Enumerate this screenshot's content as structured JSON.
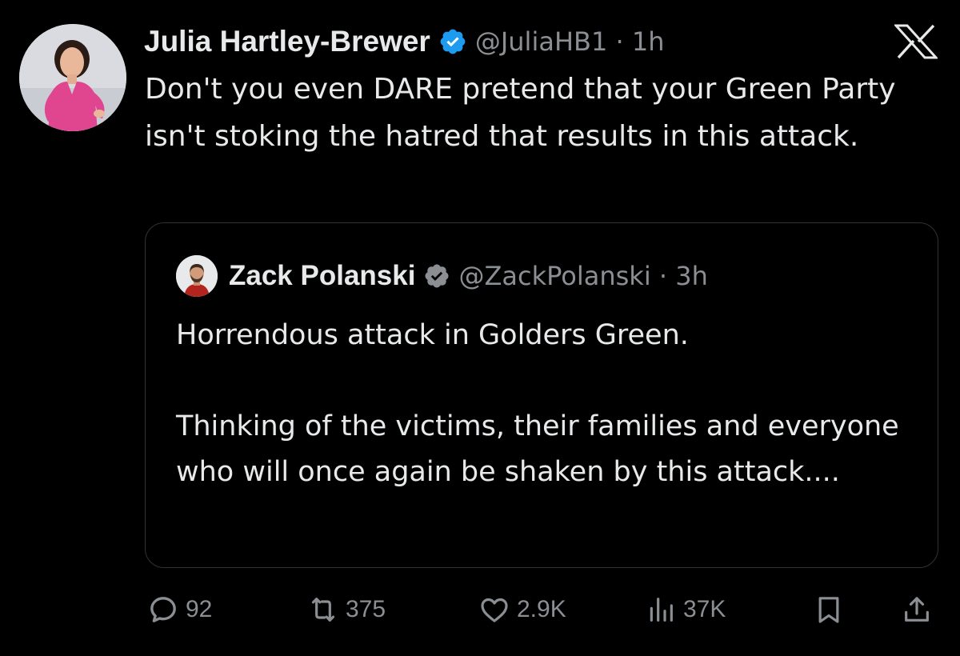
{
  "tweet": {
    "author_name": "Julia Hartley-Brewer",
    "author_handle": "@JuliaHB1",
    "time": "1h",
    "text": "Don't you even DARE pretend that your Green Party isn't stoking the hatred that results in this attack.",
    "verified": true
  },
  "quoted_tweet": {
    "author_name": "Zack Polanski",
    "author_handle": "@ZackPolanski",
    "time": "3h",
    "verified": true,
    "paragraph_1": "Horrendous attack in Golders Green.",
    "paragraph_2": "Thinking of the victims, their families and everyone who will once again be shaken by this attack...."
  },
  "actions": {
    "replies": "92",
    "reposts": "375",
    "likes": "2.9K",
    "views": "37K"
  },
  "icons": {
    "platform_logo": "x-logo-icon",
    "verified": "verified-badge-icon",
    "reply": "reply-icon",
    "repost": "repost-icon",
    "like": "heart-icon",
    "views": "views-icon",
    "bookmark": "bookmark-icon",
    "share": "share-icon"
  },
  "colors": {
    "background": "#000000",
    "text_primary": "#e7e9ea",
    "text_secondary": "#8b8f94",
    "verified_blue": "#1d9bf0",
    "card_border": "#2f3336",
    "dress_pink": "#e0458f"
  }
}
